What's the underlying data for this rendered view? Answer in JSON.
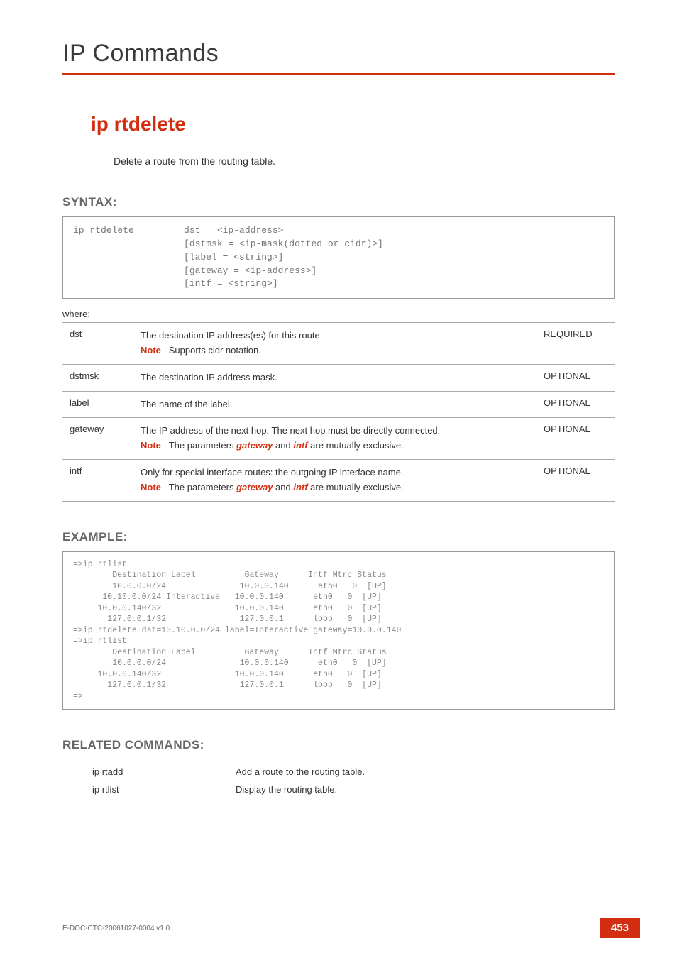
{
  "header": {
    "chapter_title": "IP Commands"
  },
  "command": {
    "title": "ip rtdelete",
    "description": "Delete a route from the routing table."
  },
  "syntax": {
    "label": "SYNTAX:",
    "code": "ip rtdelete         dst = <ip-address>\n                    [dstmsk = <ip-mask(dotted or cidr)>]\n                    [label = <string>]\n                    [gateway = <ip-address>]\n                    [intf = <string>]",
    "where_label": "where:"
  },
  "params": [
    {
      "name": "dst",
      "desc_main": "The destination IP address(es) for this route.",
      "note_label": "Note",
      "note_text": "Supports cidr notation.",
      "req": "REQUIRED"
    },
    {
      "name": "dstmsk",
      "desc_main": "The destination IP address mask.",
      "req": "OPTIONAL"
    },
    {
      "name": "label",
      "desc_main": "The name of the label.",
      "req": "OPTIONAL"
    },
    {
      "name": "gateway",
      "desc_main": "The IP address of the next hop. The next hop must be directly connected.",
      "note_label": "Note",
      "note_pre": "The parameters ",
      "note_em1": "gateway",
      "note_mid": " and ",
      "note_em2": "intf",
      "note_post": " are mutually exclusive.",
      "req": "OPTIONAL"
    },
    {
      "name": "intf",
      "desc_main": "Only for special interface routes: the outgoing IP interface name.",
      "note_label": "Note",
      "note_pre": "The parameters ",
      "note_em1": "gateway",
      "note_mid": " and ",
      "note_em2": "intf",
      "note_post": " are mutually exclusive.",
      "req": "OPTIONAL"
    }
  ],
  "example": {
    "label": "EXAMPLE:",
    "code": "=>ip rtlist\n        Destination Label          Gateway      Intf Mtrc Status\n        10.0.0.0/24               10.0.0.140      eth0   0  [UP]\n      10.10.0.0/24 Interactive   10.0.0.140      eth0   0  [UP]\n     10.0.0.140/32               10.0.0.140      eth0   0  [UP]\n       127.0.0.1/32               127.0.0.1      loop   0  [UP]\n=>ip rtdelete dst=10.10.0.0/24 label=Interactive gateway=10.0.0.140\n=>ip rtlist\n        Destination Label          Gateway      Intf Mtrc Status\n        10.0.0.0/24               10.0.0.140      eth0   0  [UP]\n     10.0.0.140/32               10.0.0.140      eth0   0  [UP]\n       127.0.0.1/32               127.0.0.1      loop   0  [UP]\n=>"
  },
  "related": {
    "label": "RELATED COMMANDS:",
    "items": [
      {
        "name": "ip rtadd",
        "desc": "Add a route to the routing table."
      },
      {
        "name": "ip rtlist",
        "desc": "Display the routing table."
      }
    ]
  },
  "footer": {
    "doc_id": "E-DOC-CTC-20061027-0004 v1.0",
    "page_number": "453"
  }
}
